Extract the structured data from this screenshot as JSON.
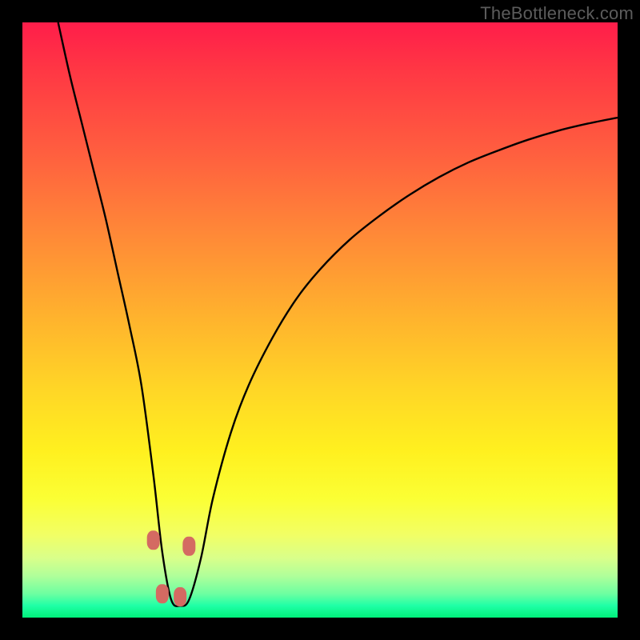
{
  "watermark": "TheBottleneck.com",
  "chart_data": {
    "type": "line",
    "title": "",
    "xlabel": "",
    "ylabel": "",
    "xlim": [
      0,
      100
    ],
    "ylim": [
      0,
      100
    ],
    "grid": false,
    "legend": false,
    "series": [
      {
        "name": "curve",
        "color": "#000000",
        "x": [
          6,
          8,
          10,
          12,
          14,
          16,
          18,
          20,
          22,
          23.5,
          25,
          26.5,
          28,
          30,
          32,
          35,
          38,
          42,
          46,
          50,
          55,
          60,
          65,
          70,
          75,
          80,
          85,
          90,
          95,
          100
        ],
        "y": [
          100,
          91,
          83,
          75,
          67,
          58,
          49,
          39,
          24,
          11,
          3,
          2,
          3,
          10,
          20,
          31,
          39,
          47,
          53.5,
          58.5,
          63.5,
          67.5,
          71,
          74,
          76.5,
          78.5,
          80.3,
          81.8,
          83,
          84
        ]
      }
    ],
    "markers": [
      {
        "x": 22.0,
        "y": 13.0
      },
      {
        "x": 23.5,
        "y": 4.0
      },
      {
        "x": 26.5,
        "y": 3.5
      },
      {
        "x": 28.0,
        "y": 12.0
      }
    ],
    "background_gradient": {
      "stops": [
        {
          "pos": 0.0,
          "color": "#ff1d4a"
        },
        {
          "pos": 0.5,
          "color": "#ffb42d"
        },
        {
          "pos": 0.8,
          "color": "#fbff34"
        },
        {
          "pos": 1.0,
          "color": "#00f07a"
        }
      ]
    }
  }
}
